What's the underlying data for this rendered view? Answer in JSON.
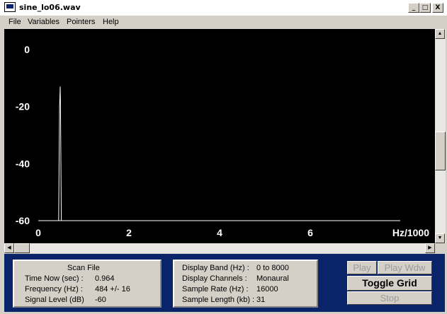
{
  "window": {
    "title": "sine_lo06.wav",
    "controls": {
      "minimize": "_",
      "maximize": "□",
      "close": "X"
    }
  },
  "menu": [
    "File",
    "Variables",
    "Pointers",
    "Help"
  ],
  "chart_data": {
    "type": "line",
    "xlabel": "Hz/1000",
    "ylabel": "",
    "x_ticks": [
      "0",
      "2",
      "4",
      "6"
    ],
    "y_ticks": [
      "0",
      "-20",
      "-40",
      "-60"
    ],
    "xlim": [
      0,
      8
    ],
    "ylim": [
      -60,
      0
    ],
    "grid": false,
    "series": [
      {
        "color": "#ffffff",
        "x": [
          0,
          0.45,
          0.46,
          0.47,
          0.484,
          0.49,
          0.5,
          0.51,
          0.52,
          0.53,
          8
        ],
        "y": [
          -60,
          -60,
          -40,
          -20,
          -13,
          -20,
          -40,
          -60,
          -60,
          -60,
          -60
        ]
      }
    ]
  },
  "scan_panel": {
    "title": "Scan File",
    "rows": [
      {
        "label": "Time Now (sec) :",
        "value": "0.964"
      },
      {
        "label": "Frequency (Hz) :",
        "value": "484  +/- 16"
      },
      {
        "label": "Signal Level (dB)",
        "value": "-60"
      }
    ]
  },
  "display_panel": {
    "rows": [
      {
        "label": "Display Band (Hz) :",
        "value": "0 to 8000"
      },
      {
        "label": "Display Channels :",
        "value": "Monaural"
      },
      {
        "label": "Sample Rate (Hz) :",
        "value": "16000"
      },
      {
        "label": "Sample Length (kb) :",
        "value": "31"
      }
    ]
  },
  "buttons": {
    "play": "Play",
    "play_window": "Play Wdw",
    "toggle_grid": "Toggle Grid",
    "stop": "Stop"
  },
  "colors": {
    "plot_background": "#000000",
    "bottom_background": "#0a246a",
    "trace": "#ffffff"
  }
}
